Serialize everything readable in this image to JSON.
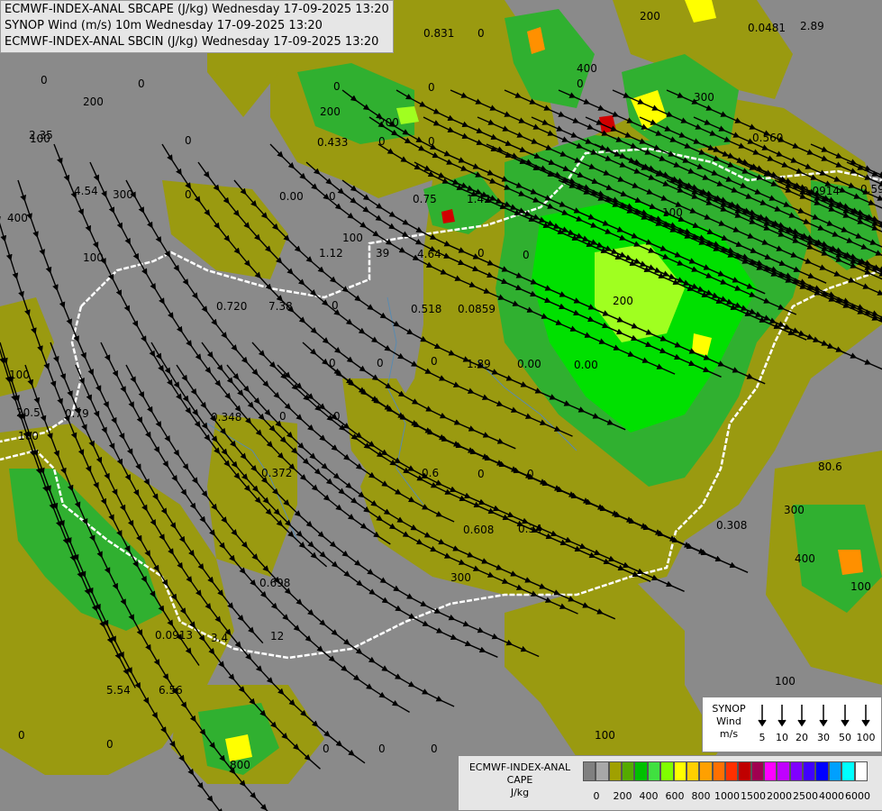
{
  "header": {
    "line1": "ECMWF-INDEX-ANAL SBCAPE (J/kg) Wednesday 17-09-2025 13:20",
    "line2": "SYNOP Wind (m/s) 10m Wednesday 17-09-2025 13:20",
    "line3": "ECMWF-INDEX-ANAL SBCIN (J/kg) Wednesday 17-09-2025 13:20"
  },
  "wind_legend": {
    "title_lines": [
      "SYNOP",
      "Wind",
      "m/s"
    ],
    "speeds": [
      "5",
      "10",
      "20",
      "30",
      "50",
      "100"
    ]
  },
  "cape_legend": {
    "title_lines": [
      "ECMWF-INDEX-ANAL",
      "CAPE",
      "J/kg"
    ],
    "ticks": [
      "0",
      "200",
      "400",
      "600",
      "800",
      "1000",
      "1500",
      "2000",
      "2500",
      "4000",
      "6000"
    ],
    "colors": [
      "#808080",
      "#a8a8a8",
      "#a0a000",
      "#55aa00",
      "#00c000",
      "#40e040",
      "#80ff00",
      "#ffff00",
      "#ffd000",
      "#ffa000",
      "#ff7000",
      "#ff3000",
      "#c00000",
      "#a00050",
      "#ff00ff",
      "#c000ff",
      "#8000ff",
      "#4000ff",
      "#0000ff",
      "#00a0ff",
      "#00ffff",
      "#ffffff"
    ]
  },
  "map_colors": {
    "background": "#8a8a8a",
    "olive": "#9a9a10",
    "green": "#30b030",
    "bright_green": "#00e000",
    "lime": "#a0ff20",
    "yellow": "#ffff00",
    "orange": "#ff9000",
    "red": "#d00000",
    "border": "#ffffff"
  },
  "map_labels": [
    {
      "text": "0.831"
    },
    {
      "text": "0"
    },
    {
      "text": "0.0481"
    },
    {
      "text": "2.89"
    },
    {
      "text": "0"
    },
    {
      "text": "0"
    },
    {
      "text": "0"
    },
    {
      "text": "0"
    },
    {
      "text": "0"
    },
    {
      "text": "2.35"
    },
    {
      "text": "0"
    },
    {
      "text": "0.433"
    },
    {
      "text": "0"
    },
    {
      "text": "0"
    },
    {
      "text": "0.560"
    },
    {
      "text": "4.54"
    },
    {
      "text": "0"
    },
    {
      "text": "0.00"
    },
    {
      "text": "0"
    },
    {
      "text": "0.75"
    },
    {
      "text": "1.42"
    },
    {
      "text": "0.0914"
    },
    {
      "text": "0.598"
    },
    {
      "text": "1.12"
    },
    {
      "text": "39"
    },
    {
      "text": "4.64"
    },
    {
      "text": "0"
    },
    {
      "text": "0"
    },
    {
      "text": "0.720"
    },
    {
      "text": "7.38"
    },
    {
      "text": "0"
    },
    {
      "text": "0.518"
    },
    {
      "text": "0.0859"
    },
    {
      "text": "0"
    },
    {
      "text": "0"
    },
    {
      "text": "0"
    },
    {
      "text": "1.89"
    },
    {
      "text": "0.00"
    },
    {
      "text": "0.00"
    },
    {
      "text": "20.5"
    },
    {
      "text": "0.79"
    },
    {
      "text": "0.348"
    },
    {
      "text": "0"
    },
    {
      "text": "0"
    },
    {
      "text": "0.372"
    },
    {
      "text": "0.6"
    },
    {
      "text": "80.6"
    },
    {
      "text": "0"
    },
    {
      "text": "0"
    },
    {
      "text": "0.698"
    },
    {
      "text": "0.608"
    },
    {
      "text": "0.34"
    },
    {
      "text": "0.308"
    },
    {
      "text": "0.0913"
    },
    {
      "text": "3.4"
    },
    {
      "text": "12"
    },
    {
      "text": "5.54"
    },
    {
      "text": "6.56"
    },
    {
      "text": "0"
    },
    {
      "text": "0"
    },
    {
      "text": "0"
    },
    {
      "text": "0"
    },
    {
      "text": "0"
    },
    {
      "text": "100"
    },
    {
      "text": "200"
    },
    {
      "text": "300"
    },
    {
      "text": "400"
    },
    {
      "text": "100"
    },
    {
      "text": "200"
    },
    {
      "text": "300"
    },
    {
      "text": "100"
    },
    {
      "text": "200"
    },
    {
      "text": "300"
    },
    {
      "text": "400"
    },
    {
      "text": "100"
    },
    {
      "text": "200"
    },
    {
      "text": "200"
    },
    {
      "text": "300"
    },
    {
      "text": "100"
    },
    {
      "text": "100"
    },
    {
      "text": "100"
    },
    {
      "text": "800"
    },
    {
      "text": "400"
    },
    {
      "text": "100"
    },
    {
      "text": "100"
    }
  ]
}
